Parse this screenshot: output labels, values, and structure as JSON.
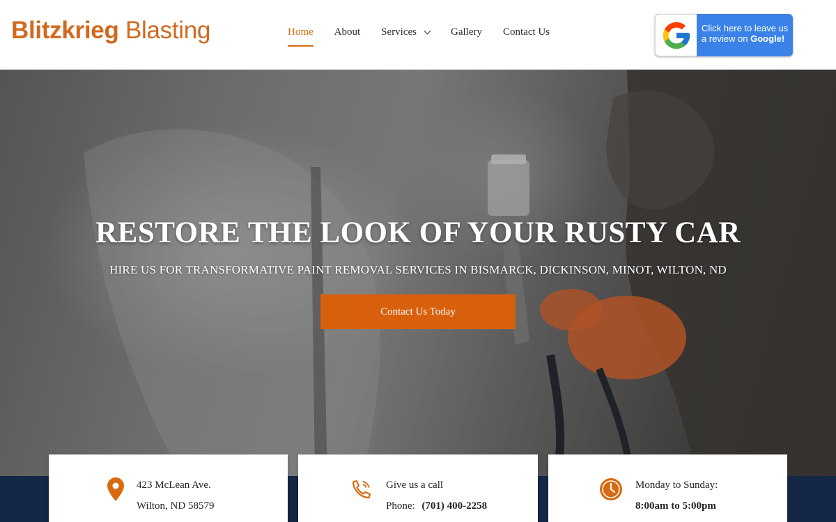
{
  "header": {
    "logo_bold": "Blitzkrieg",
    "logo_light": "Blasting",
    "nav": [
      {
        "label": "Home"
      },
      {
        "label": "About"
      },
      {
        "label": "Services"
      },
      {
        "label": "Gallery"
      },
      {
        "label": "Contact Us"
      }
    ],
    "review_line1": "Click here to leave us",
    "review_line2_prefix": "a review on",
    "review_line2_brand": "Google!"
  },
  "hero": {
    "title": "RESTORE THE LOOK OF YOUR RUSTY CAR",
    "subtitle": "HIRE US FOR TRANSFORMATIVE PAINT REMOVAL SERVICES IN BISMARCK, DICKINSON, MINOT, WILTON, ND",
    "cta": "Contact Us Today"
  },
  "info_cards": {
    "address": {
      "line1": "423 McLean Ave.",
      "line2": "Wilton, ND 58579"
    },
    "phone": {
      "line1": "Give us a call",
      "line2_label": "Phone:",
      "line2_value": "(701) 400-2258"
    },
    "hours": {
      "line1": "Monday to Sunday:",
      "line2": "8:00am to 5:00pm"
    }
  },
  "colors": {
    "accent": "#d86a12",
    "button": "#d8600d",
    "band": "#152747",
    "google_blue": "#3b82e8"
  }
}
